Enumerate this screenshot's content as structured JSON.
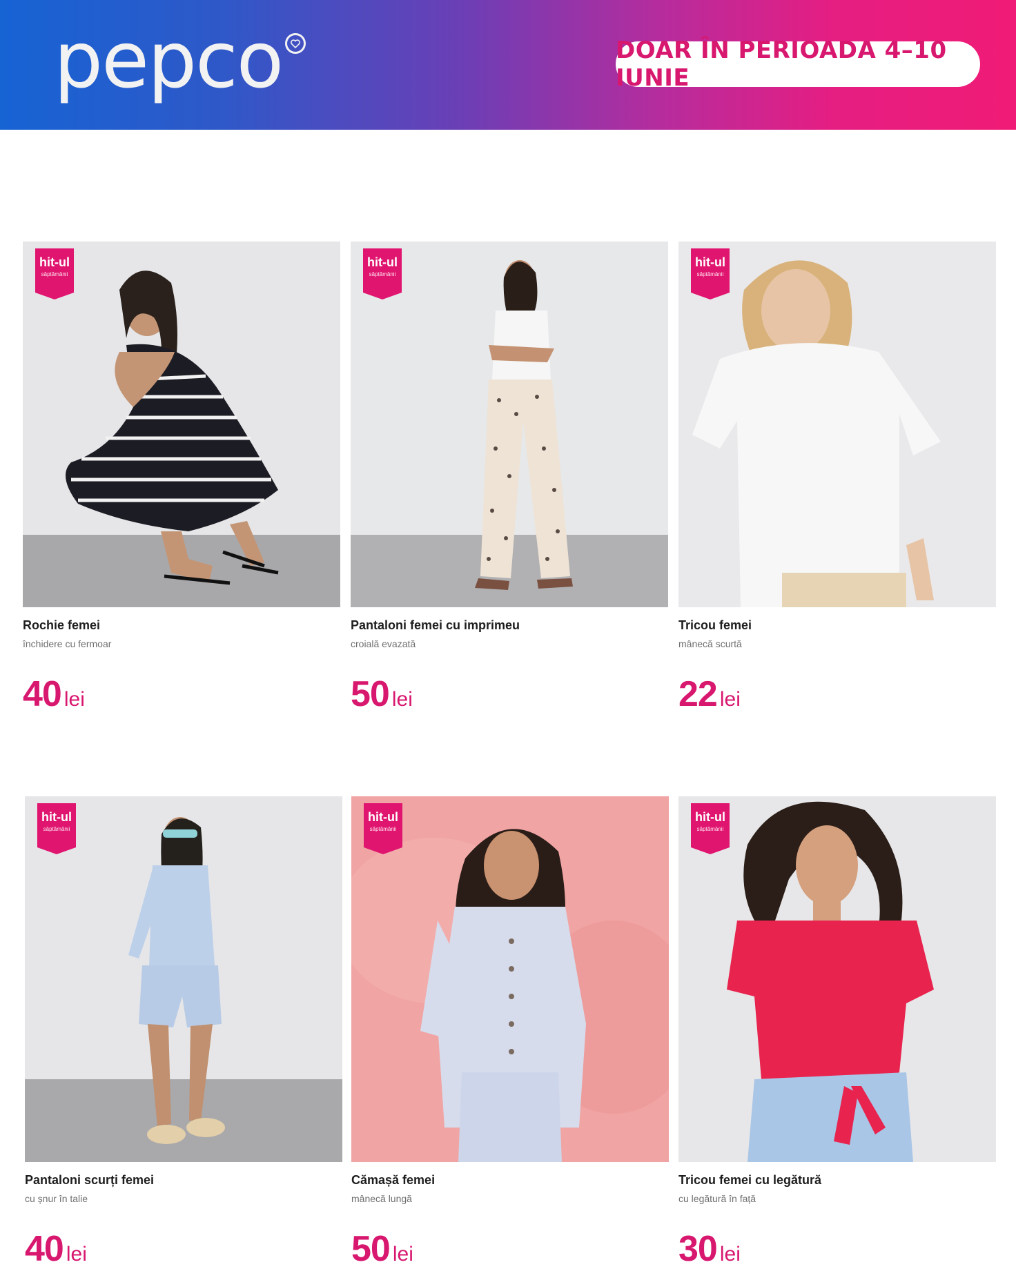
{
  "header": {
    "brand": "pepco",
    "promo": "DOAR ÎN PERIOADA 4–10 IUNIE",
    "gradient_colors": [
      "#1663d4",
      "#6a3fb6",
      "#e51e82"
    ]
  },
  "badge": {
    "main": "hit-ul",
    "sub": "săptămânii",
    "color": "#e0156f"
  },
  "accent_color": "#d8176f",
  "products": [
    {
      "title": "Rochie femei",
      "subtitle": "închidere cu fermoar",
      "price": "40",
      "currency": "lei"
    },
    {
      "title": "Pantaloni femei cu imprimeu",
      "subtitle": "croială evazată",
      "price": "50",
      "currency": "lei"
    },
    {
      "title": "Tricou femei",
      "subtitle": "mânecă scurtă",
      "price": "22",
      "currency": "lei"
    },
    {
      "title": "Pantaloni scurți femei",
      "subtitle": "cu șnur în talie",
      "price": "40",
      "currency": "lei"
    },
    {
      "title": "Cămașă femei",
      "subtitle": "mânecă lungă",
      "price": "50",
      "currency": "lei"
    },
    {
      "title": "Tricou femei cu legătură",
      "subtitle": "cu legătură în față",
      "price": "30",
      "currency": "lei"
    }
  ]
}
